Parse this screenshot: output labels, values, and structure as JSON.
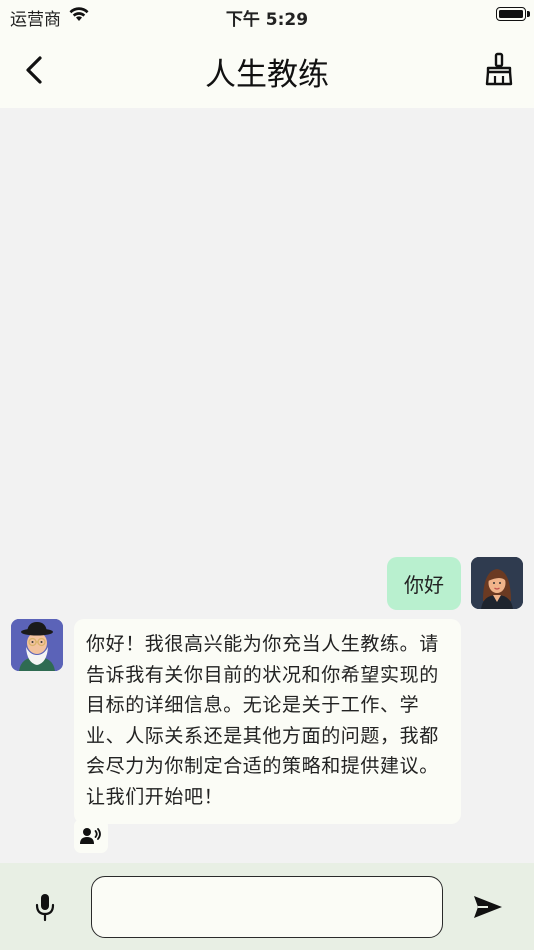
{
  "status_bar": {
    "carrier": "运营商",
    "time": "下午 5:29",
    "wifi_icon": "wifi-icon",
    "battery_icon": "battery-icon"
  },
  "nav": {
    "title": "人生教练",
    "back_icon": "chevron-left-icon",
    "clear_icon": "broom-icon"
  },
  "messages": [
    {
      "role": "user",
      "text": "你好",
      "avatar": "user-avatar"
    },
    {
      "role": "assistant",
      "text": "你好！我很高兴能为你充当人生教练。请告诉我有关你目前的状况和你希望实现的目标的详细信息。无论是关于工作、学业、人际关系还是其他方面的问题，我都会尽力为你制定合适的策略和提供建议。让我们开始吧！",
      "avatar": "coach-avatar"
    }
  ],
  "voice_play_icon": "speaker-person-icon",
  "input": {
    "placeholder": "",
    "value": "",
    "mic_icon": "microphone-icon",
    "send_icon": "send-icon"
  },
  "colors": {
    "user_bubble": "#b9f0cf",
    "bot_bubble": "#fbfcf6",
    "background": "#f2f2f2",
    "bar_background": "#fbfcf6",
    "input_bar_background": "#e8efe4"
  }
}
